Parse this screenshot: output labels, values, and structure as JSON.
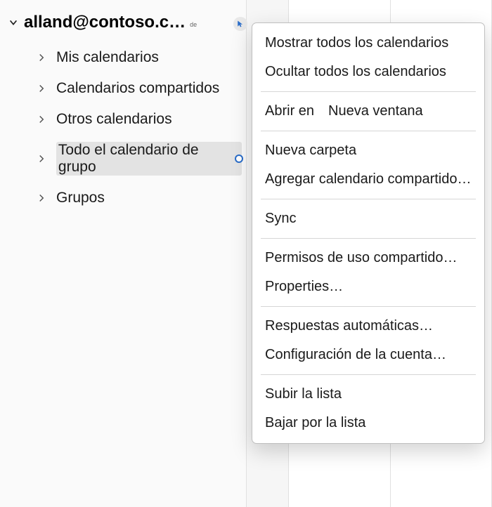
{
  "account": {
    "name": "alland@contoso.c…",
    "badge": "de"
  },
  "tree": {
    "items": [
      {
        "label": "Mis calendarios",
        "selected": false
      },
      {
        "label": "Calendarios compartidos",
        "selected": false
      },
      {
        "label": "Otros calendarios",
        "selected": false
      },
      {
        "label": "Todo el calendario de grupo",
        "selected": true
      },
      {
        "label": "Grupos",
        "selected": false
      }
    ]
  },
  "menu": {
    "show_all": "Mostrar todos los calendarios",
    "hide_all": "Ocultar todos los calendarios",
    "open_in_label": "Abrir en",
    "open_in_value": "Nueva ventana",
    "new_folder": "Nueva carpeta",
    "add_shared": "Agregar calendario compartido…",
    "sync": "Sync",
    "sharing_permissions": "Permisos de uso compartido…",
    "properties": "Properties…",
    "auto_replies": "Respuestas automáticas…",
    "account_settings": "Configuración de la cuenta…",
    "move_up": "Subir la lista",
    "move_down": "Bajar por la lista"
  }
}
